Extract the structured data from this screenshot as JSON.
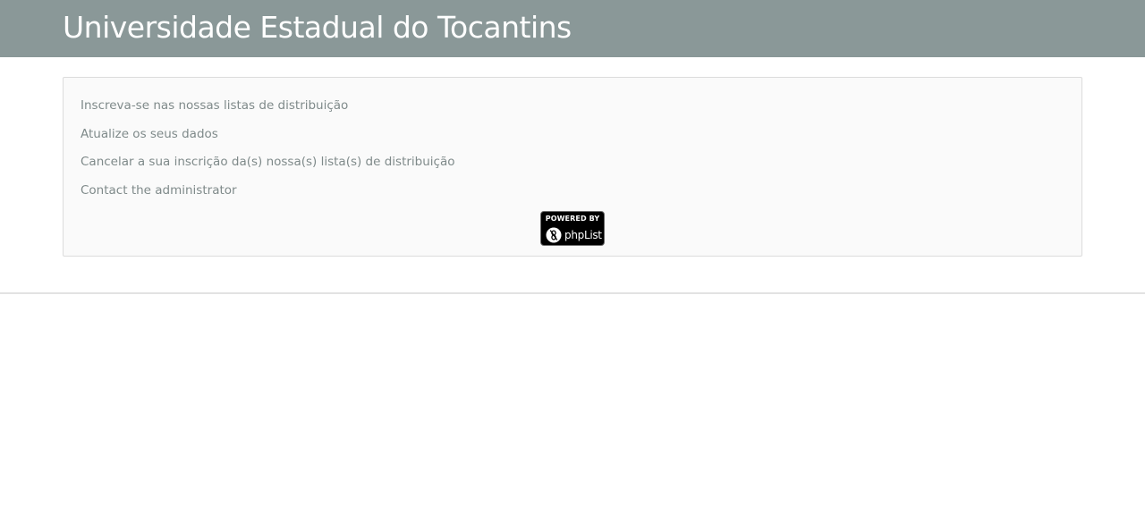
{
  "header": {
    "title": "Universidade Estadual do Tocantins",
    "background_color": "#8a9898"
  },
  "panel": {
    "links": [
      {
        "label": "Inscreva-se nas nossas listas de distribuição"
      },
      {
        "label": "Atualize os seus dados"
      },
      {
        "label": "Cancelar a sua inscrição da(s) nossa(s) lista(s) de distribuição"
      },
      {
        "label": "Contact the administrator"
      }
    ],
    "link_color": "#7f8a8a"
  },
  "badge": {
    "top_text": "POWERED BY",
    "name": "phpList",
    "icon": "phplist-logo-icon"
  }
}
